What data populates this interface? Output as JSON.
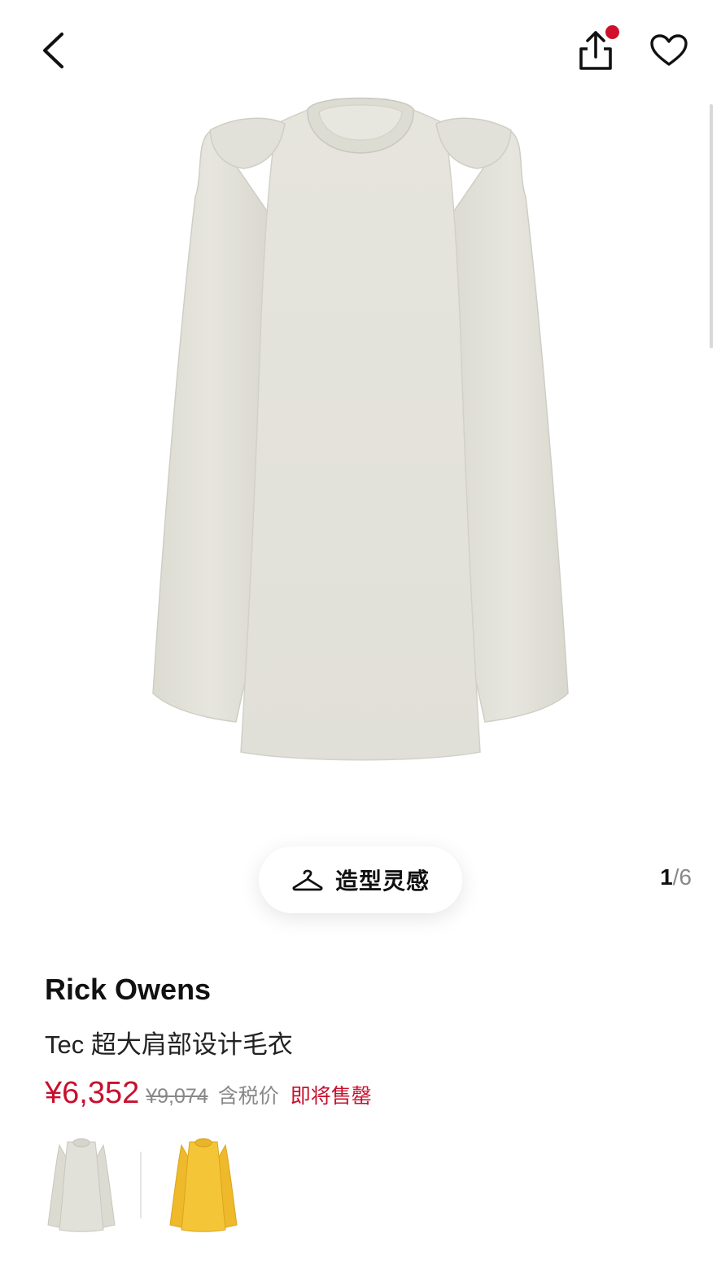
{
  "header": {
    "back_icon": "chevron-left-icon",
    "share_icon": "share-icon",
    "favorite_icon": "heart-icon",
    "notification_color": "#d0102a"
  },
  "gallery": {
    "current": "1",
    "separator": "/",
    "total": "6",
    "product_color": "#e4e3db"
  },
  "styling": {
    "icon": "hanger-icon",
    "label": "造型灵感"
  },
  "product": {
    "brand": "Rick Owens",
    "title": "Tec 超大肩部设计毛衣",
    "price": "¥6,352",
    "original_price": "¥9,074",
    "tax_note": "含税价",
    "status": "即将售罄",
    "price_color": "#c8102e"
  },
  "variants": [
    {
      "color_name": "grey",
      "color": "#e2e1d9"
    },
    {
      "color_name": "yellow",
      "color": "#f2c233"
    }
  ]
}
